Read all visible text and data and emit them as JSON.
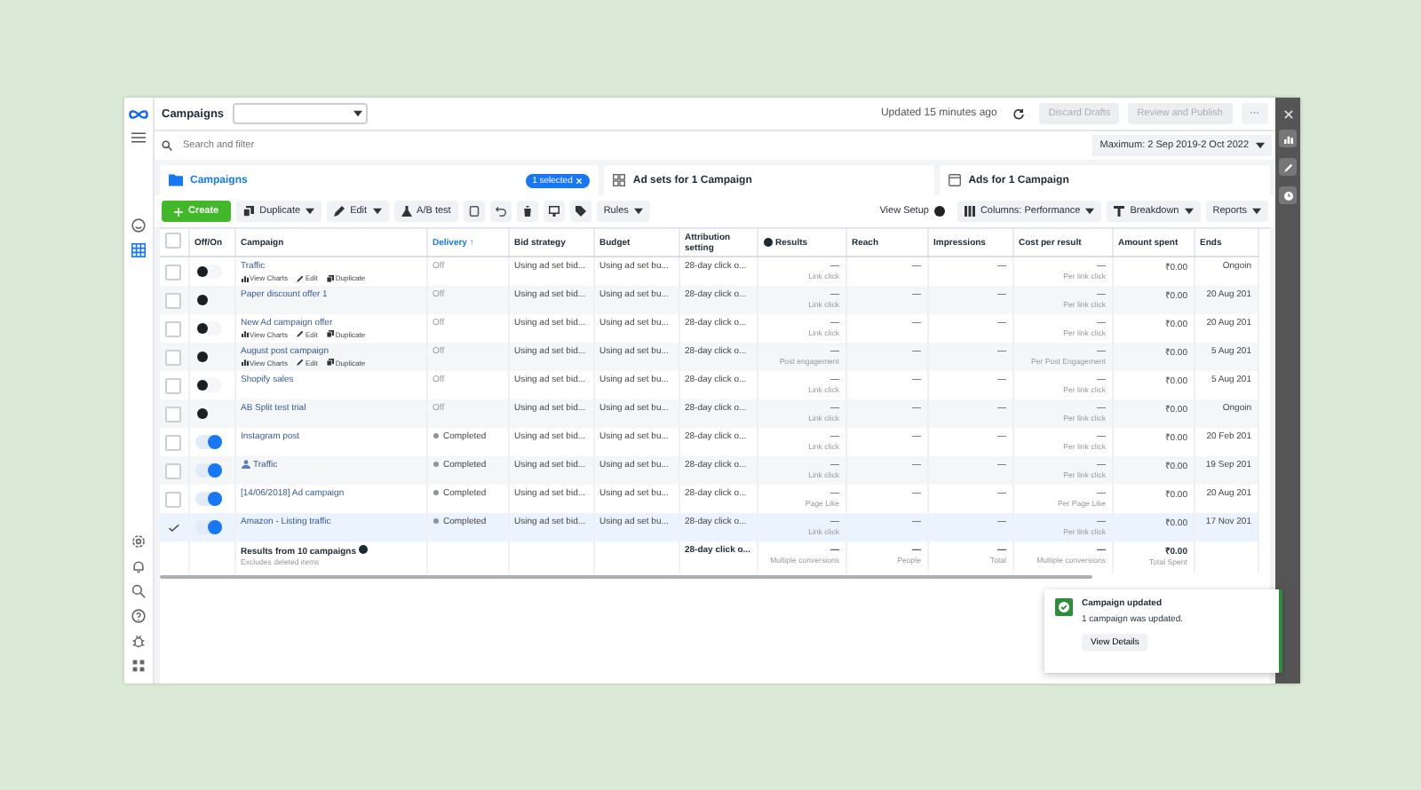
{
  "header": {
    "title": "Campaigns",
    "updated": "Updated 15 minutes ago",
    "buttons": [
      {
        "label": "Discard Drafts",
        "disabled": true
      },
      {
        "label": "Review and Publish",
        "disabled": true
      }
    ],
    "more": "···"
  },
  "rail": [
    {
      "kind": "face",
      "selected": false
    },
    {
      "kind": "table",
      "selected": true
    }
  ],
  "rail_bottom": [
    {
      "kind": "gear"
    },
    {
      "kind": "bell"
    },
    {
      "kind": "search"
    },
    {
      "kind": "help"
    },
    {
      "kind": "bug"
    },
    {
      "kind": "grid"
    }
  ],
  "search": {
    "placeholder": "Search and filter"
  },
  "date_range": "Maximum: 2 Sep 2019-2 Oct 2022",
  "tabs": [
    {
      "label": "Campaigns",
      "selected": true,
      "badge": "1 selected"
    },
    {
      "label": "Ad sets for 1 Campaign",
      "selected": false
    },
    {
      "label": "Ads for 1 Campaign",
      "selected": false
    }
  ],
  "toolbar": {
    "create": "Create",
    "duplicate": "Duplicate",
    "edit": "Edit",
    "ab_test": "A/B test",
    "rules": "Rules",
    "view_setup": "View Setup",
    "columns": "Columns: Performance",
    "breakdown": "Breakdown",
    "reports": "Reports"
  },
  "table": {
    "select_all": false,
    "columns": [
      "Off/On",
      "Campaign",
      "Delivery ↑",
      "Bid strategy",
      "Budget",
      "Attribution setting",
      "Results",
      "Reach",
      "Impressions",
      "Cost per result",
      "Amount spent",
      "Ends"
    ],
    "rows": [
      {
        "selected": false,
        "on": false,
        "name": "Traffic",
        "actions": [
          "View Charts",
          "Edit",
          "Duplicate"
        ],
        "delivery": "Off",
        "kind": "off",
        "bid": "Using ad set bid...",
        "budget": "Using ad set bu...",
        "attribution": "28-day click o...",
        "results": "—",
        "results_sub": "Link click",
        "reach": "—",
        "impressions": "—",
        "cost": "—",
        "cost_sub": "Per link click",
        "amount": "₹0.00",
        "ends": "Ongoin"
      },
      {
        "selected": false,
        "on": false,
        "name": "Paper discount offer 1",
        "delivery": "Off",
        "kind": "off",
        "bid": "Using ad set bid...",
        "budget": "Using ad set bu...",
        "attribution": "28-day click o...",
        "results": "—",
        "results_sub": "Link click",
        "reach": "—",
        "impressions": "—",
        "cost": "—",
        "cost_sub": "Per link click",
        "amount": "₹0.00",
        "ends": "20 Aug 201"
      },
      {
        "selected": false,
        "on": false,
        "name": "New Ad campaign offer",
        "actions": [
          "View Charts",
          "Edit",
          "Duplicate"
        ],
        "delivery": "Off",
        "kind": "off",
        "bid": "Using ad set bid...",
        "budget": "Using ad set bu...",
        "attribution": "28-day click o...",
        "results": "—",
        "results_sub": "Link click",
        "reach": "—",
        "impressions": "—",
        "cost": "—",
        "cost_sub": "Per link click",
        "amount": "₹0.00",
        "ends": "20 Aug 201"
      },
      {
        "selected": false,
        "on": false,
        "name": "August post campaign",
        "actions": [
          "View Charts",
          "Edit",
          "Duplicate"
        ],
        "delivery": "Off",
        "kind": "off",
        "bid": "Using ad set bid...",
        "budget": "Using ad set bu...",
        "attribution": "28-day click o...",
        "results": "—",
        "results_sub": "Post engagement",
        "reach": "—",
        "impressions": "—",
        "cost": "—",
        "cost_sub": "Per Post Engagement",
        "amount": "₹0.00",
        "ends": "5 Aug 201"
      },
      {
        "selected": false,
        "on": false,
        "name": "Shopify sales",
        "delivery": "Off",
        "kind": "off",
        "bid": "Using ad set bid...",
        "budget": "Using ad set bu...",
        "attribution": "28-day click o...",
        "results": "—",
        "results_sub": "Link click",
        "reach": "—",
        "impressions": "—",
        "cost": "—",
        "cost_sub": "Per link click",
        "amount": "₹0.00",
        "ends": "5 Aug 201"
      },
      {
        "selected": false,
        "on": false,
        "name": "AB Split test trial",
        "delivery": "Off",
        "kind": "off",
        "bid": "Using ad set bid...",
        "budget": "Using ad set bu...",
        "attribution": "28-day click o...",
        "results": "—",
        "results_sub": "Link click",
        "reach": "—",
        "impressions": "—",
        "cost": "—",
        "cost_sub": "Per link click",
        "amount": "₹0.00",
        "ends": "Ongoin"
      },
      {
        "selected": false,
        "on": true,
        "name": "Instagram post",
        "delivery": "Completed",
        "kind": "completed",
        "bid": "Using ad set bid...",
        "budget": "Using ad set bu...",
        "attribution": "28-day click o...",
        "results": "—",
        "results_sub": "Link click",
        "reach": "—",
        "impressions": "—",
        "cost": "—",
        "cost_sub": "Per link click",
        "amount": "₹0.00",
        "ends": "20 Feb 201"
      },
      {
        "selected": false,
        "on": true,
        "name": "Traffic",
        "person": true,
        "delivery": "Completed",
        "kind": "completed",
        "bid": "Using ad set bid...",
        "budget": "Using ad set bu...",
        "attribution": "28-day click o...",
        "results": "—",
        "results_sub": "Link click",
        "reach": "—",
        "impressions": "—",
        "cost": "—",
        "cost_sub": "Per link click",
        "amount": "₹0.00",
        "ends": "19 Sep 201"
      },
      {
        "selected": false,
        "on": true,
        "name": "[14/06/2018] Ad campaign",
        "delivery": "Completed",
        "kind": "completed",
        "bid": "Using ad set bid...",
        "budget": "Using ad set bu...",
        "attribution": "28-day click o...",
        "results": "—",
        "results_sub": "Page Like",
        "reach": "—",
        "impressions": "—",
        "cost": "—",
        "cost_sub": "Per Page Like",
        "amount": "₹0.00",
        "ends": "20 Aug 201"
      },
      {
        "selected": true,
        "on": true,
        "name": "Amazon - Listing traffic",
        "delivery": "Completed",
        "kind": "completed",
        "bid": "Using ad set bid...",
        "budget": "Using ad set bu...",
        "attribution": "28-day click o...",
        "results": "—",
        "results_sub": "Link click",
        "reach": "—",
        "impressions": "—",
        "cost": "—",
        "cost_sub": "Per link click",
        "amount": "₹0.00",
        "ends": "17 Nov 201"
      }
    ],
    "summary": {
      "title": "Results from 10 campaigns",
      "note": "Excludes deleted items",
      "attribution": "28-day click o...",
      "results": "—",
      "results_sub": "Multiple conversions",
      "reach": "—",
      "reach_sub": "People",
      "impressions": "—",
      "impressions_sub": "Total",
      "cost": "—",
      "cost_sub": "Multiple conversions",
      "amount": "₹0.00",
      "amount_sub": "Total Spent"
    }
  },
  "toast": {
    "title": "Campaign updated",
    "message": "1 campaign was updated.",
    "button": "View Details"
  }
}
